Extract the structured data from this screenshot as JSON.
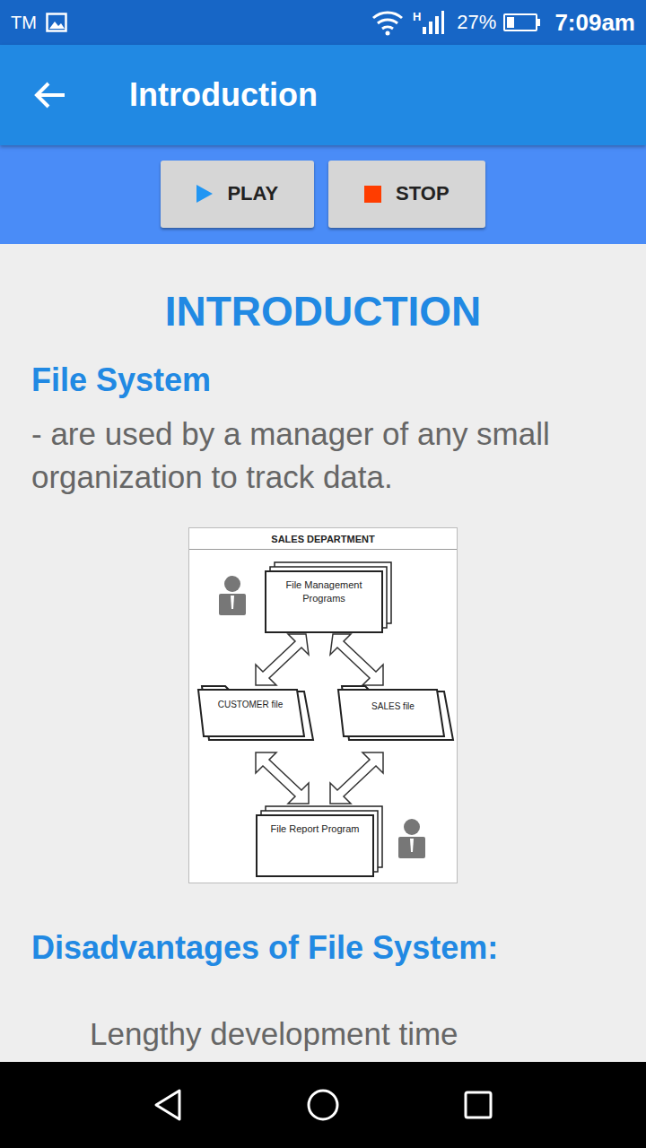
{
  "status_bar": {
    "carrier": "TM",
    "network": "H",
    "battery": "27%",
    "battery_level": 0.27,
    "time": "7:09am"
  },
  "app_bar": {
    "title": "Introduction"
  },
  "buttons": [
    {
      "label": "PLAY",
      "kind": "play"
    },
    {
      "label": "STOP",
      "kind": "stop"
    }
  ],
  "content": {
    "heading": "INTRODUCTION",
    "section_title": "File System",
    "section_text": "- are used by a manager of any small organization to track data.",
    "diagram": {
      "title": "SALES DEPARTMENT",
      "top_node": "File Management Programs",
      "left_folder": "CUSTOMER file",
      "right_folder": "SALES file",
      "bottom_node": "File Report Program"
    },
    "list_title": "Disadvantages of File System:",
    "list_items": [
      "Lengthy development time"
    ]
  }
}
